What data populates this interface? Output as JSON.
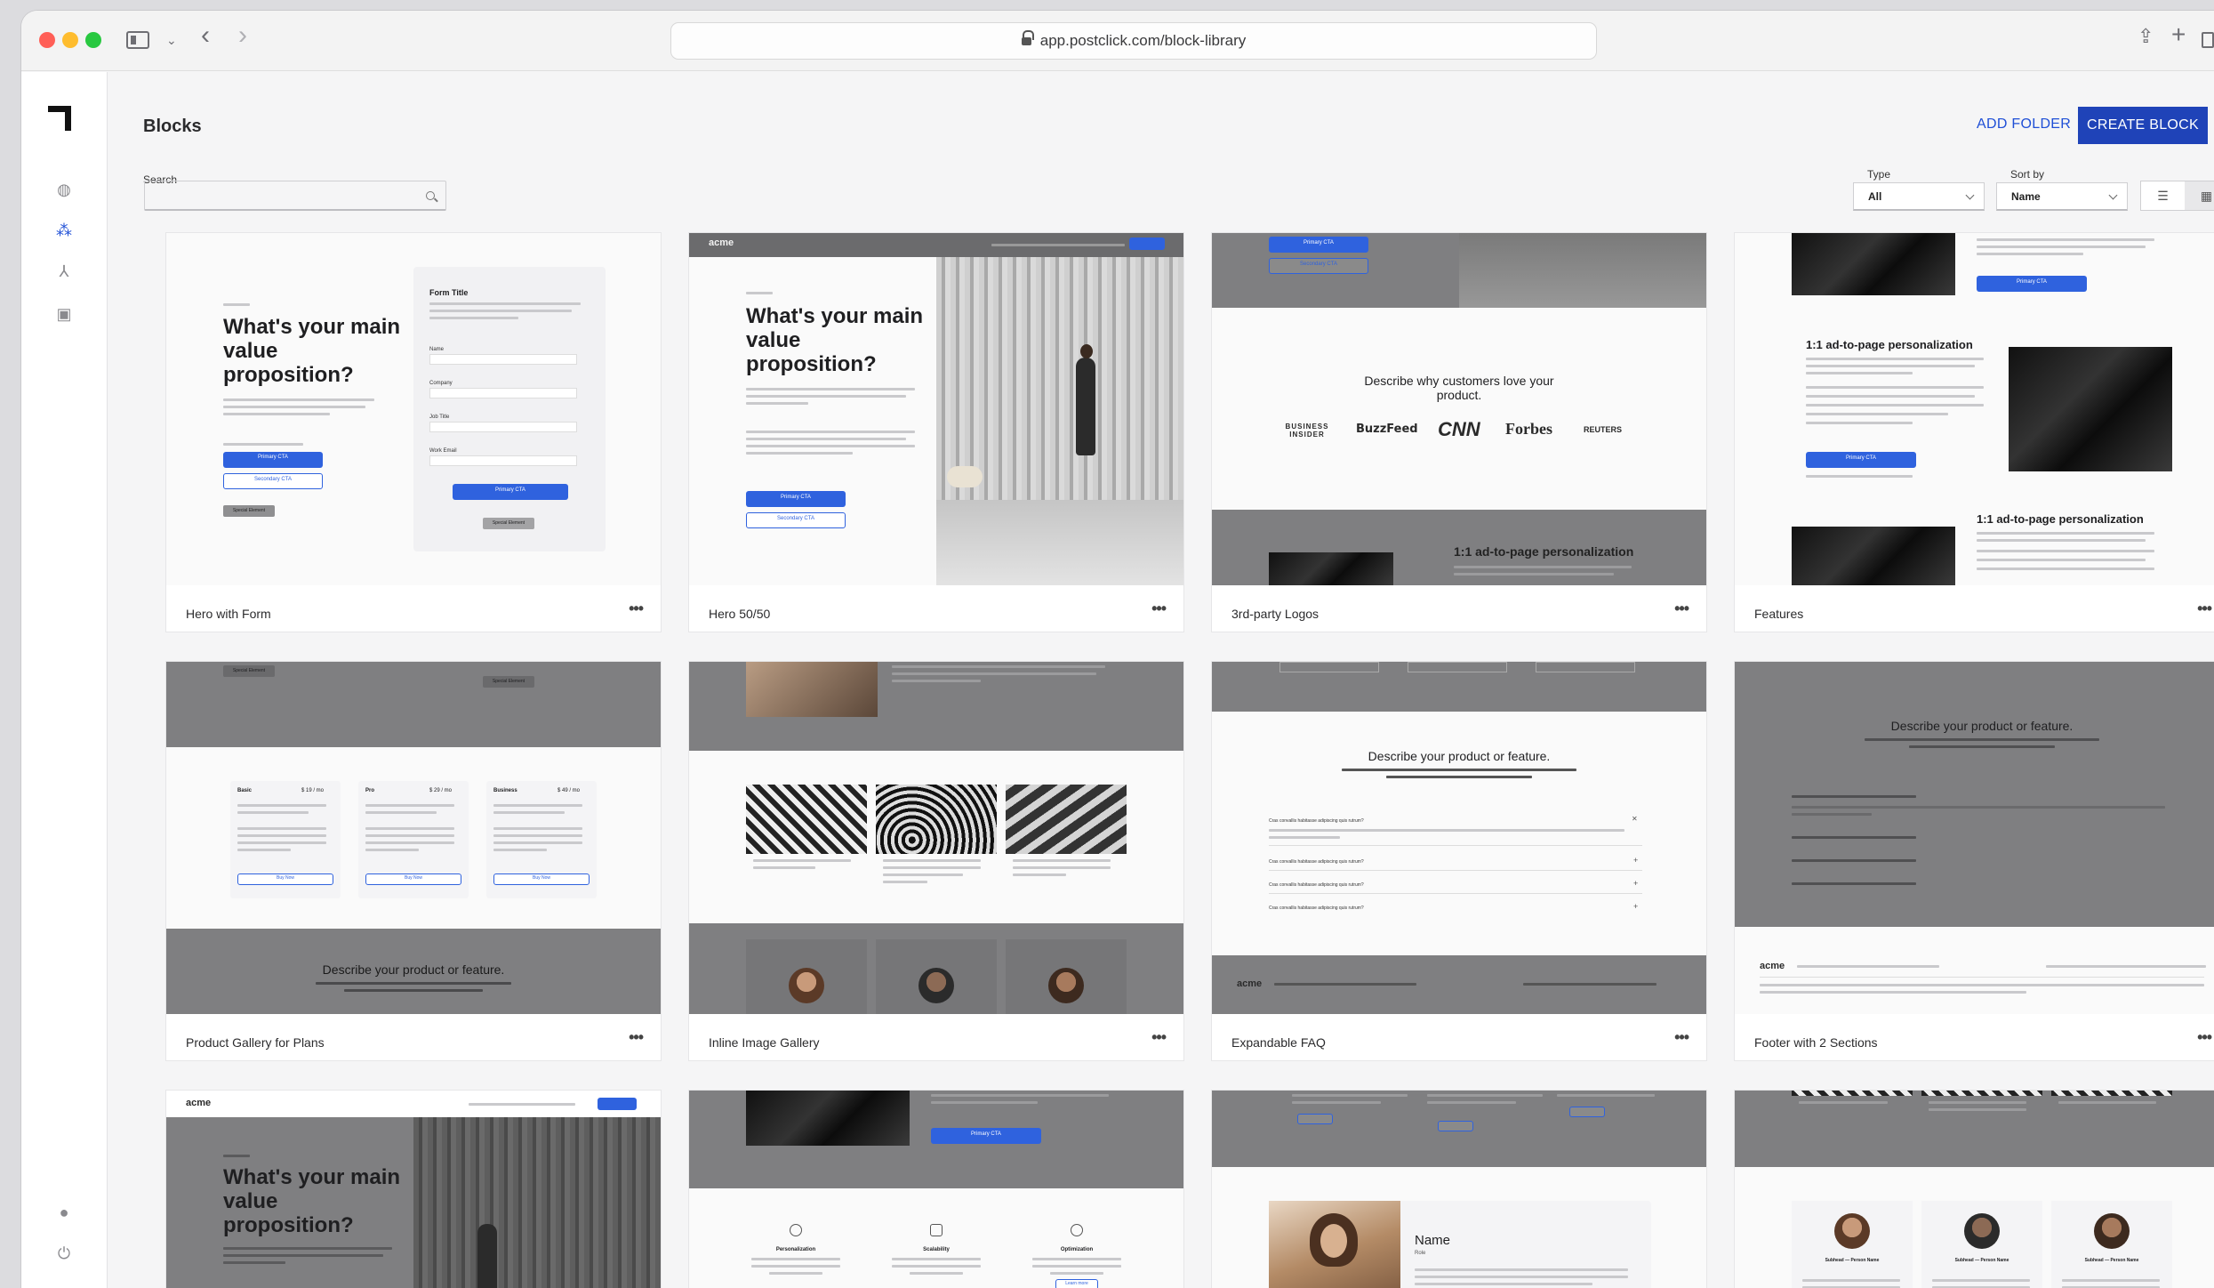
{
  "browser": {
    "url": "app.postclick.com/block-library"
  },
  "page": {
    "title": "Blocks",
    "add_folder": "ADD FOLDER",
    "create_block": "CREATE BLOCK"
  },
  "filters": {
    "search_label": "Search",
    "search_value": "",
    "type_label": "Type",
    "type_value": "All",
    "sort_label": "Sort by",
    "sort_value": "Name"
  },
  "cards": [
    {
      "title": "Hero with Form",
      "more": "•••"
    },
    {
      "title": "Hero 50/50",
      "more": "•••"
    },
    {
      "title": "3rd-party Logos",
      "more": "•••"
    },
    {
      "title": "Features",
      "more": "•••"
    },
    {
      "title": "Product Gallery for Plans",
      "more": "•••"
    },
    {
      "title": "Inline Image Gallery",
      "more": "•••"
    },
    {
      "title": "Expandable FAQ",
      "more": "•••"
    },
    {
      "title": "Footer with 2 Sections",
      "more": "•••"
    },
    {
      "title": "",
      "more": ""
    },
    {
      "title": "",
      "more": ""
    },
    {
      "title": "",
      "more": ""
    },
    {
      "title": "",
      "more": ""
    }
  ],
  "thumbs": {
    "hero_form": {
      "headline": "What's your main value proposition?",
      "form_title": "Form Title",
      "fields": [
        "Name",
        "Company",
        "Job Title",
        "Work Email"
      ],
      "primary": "Primary CTA",
      "secondary": "Secondary CTA",
      "special": "Special Element"
    },
    "hero_5050": {
      "brand": "acme",
      "headline": "What's your main value proposition?",
      "primary": "Primary CTA",
      "secondary": "Secondary CTA"
    },
    "logos": {
      "headline": "Describe why customers love your product.",
      "logos": [
        "BUSINESS INSIDER",
        "BuzzFeed",
        "CNN",
        "Forbes",
        "REUTERS"
      ],
      "bottom": "1:1 ad-to-page personalization",
      "primary": "Primary CTA",
      "secondary": "Secondary CTA"
    },
    "features": {
      "heading1": "1:1 ad-to-page personalization",
      "heading2": "1:1 ad-to-page personalization",
      "primary": "Primary CTA"
    },
    "plans": {
      "plans": [
        {
          "name": "Basic",
          "price": "$ 19 / mo"
        },
        {
          "name": "Pro",
          "price": "$ 29 / mo"
        },
        {
          "name": "Business",
          "price": "$ 49 / mo"
        }
      ],
      "buy": "Buy Now",
      "headline": "Describe your product or feature.",
      "special": "Special Element"
    },
    "faq": {
      "headline": "Describe your product or feature.",
      "q": "Cras convallis habitasse adipiscing quis rutrum?",
      "brand": "acme"
    },
    "footer": {
      "headline": "Describe your product or feature.",
      "brand": "acme"
    },
    "hero_gray": {
      "brand": "acme",
      "headline": "What's your main value proposition?"
    },
    "icons3": {
      "items": [
        "Personalization",
        "Scalability",
        "Optimization"
      ],
      "primary": "Primary CTA",
      "learn": "Learn more"
    },
    "profile": {
      "name": "Name",
      "role": "Role"
    },
    "team": {
      "subhead": "Subhead — Person Name"
    }
  },
  "colors": {
    "accent": "#1f43b8",
    "link": "#1f4fd6",
    "cta": "#2f62de"
  }
}
